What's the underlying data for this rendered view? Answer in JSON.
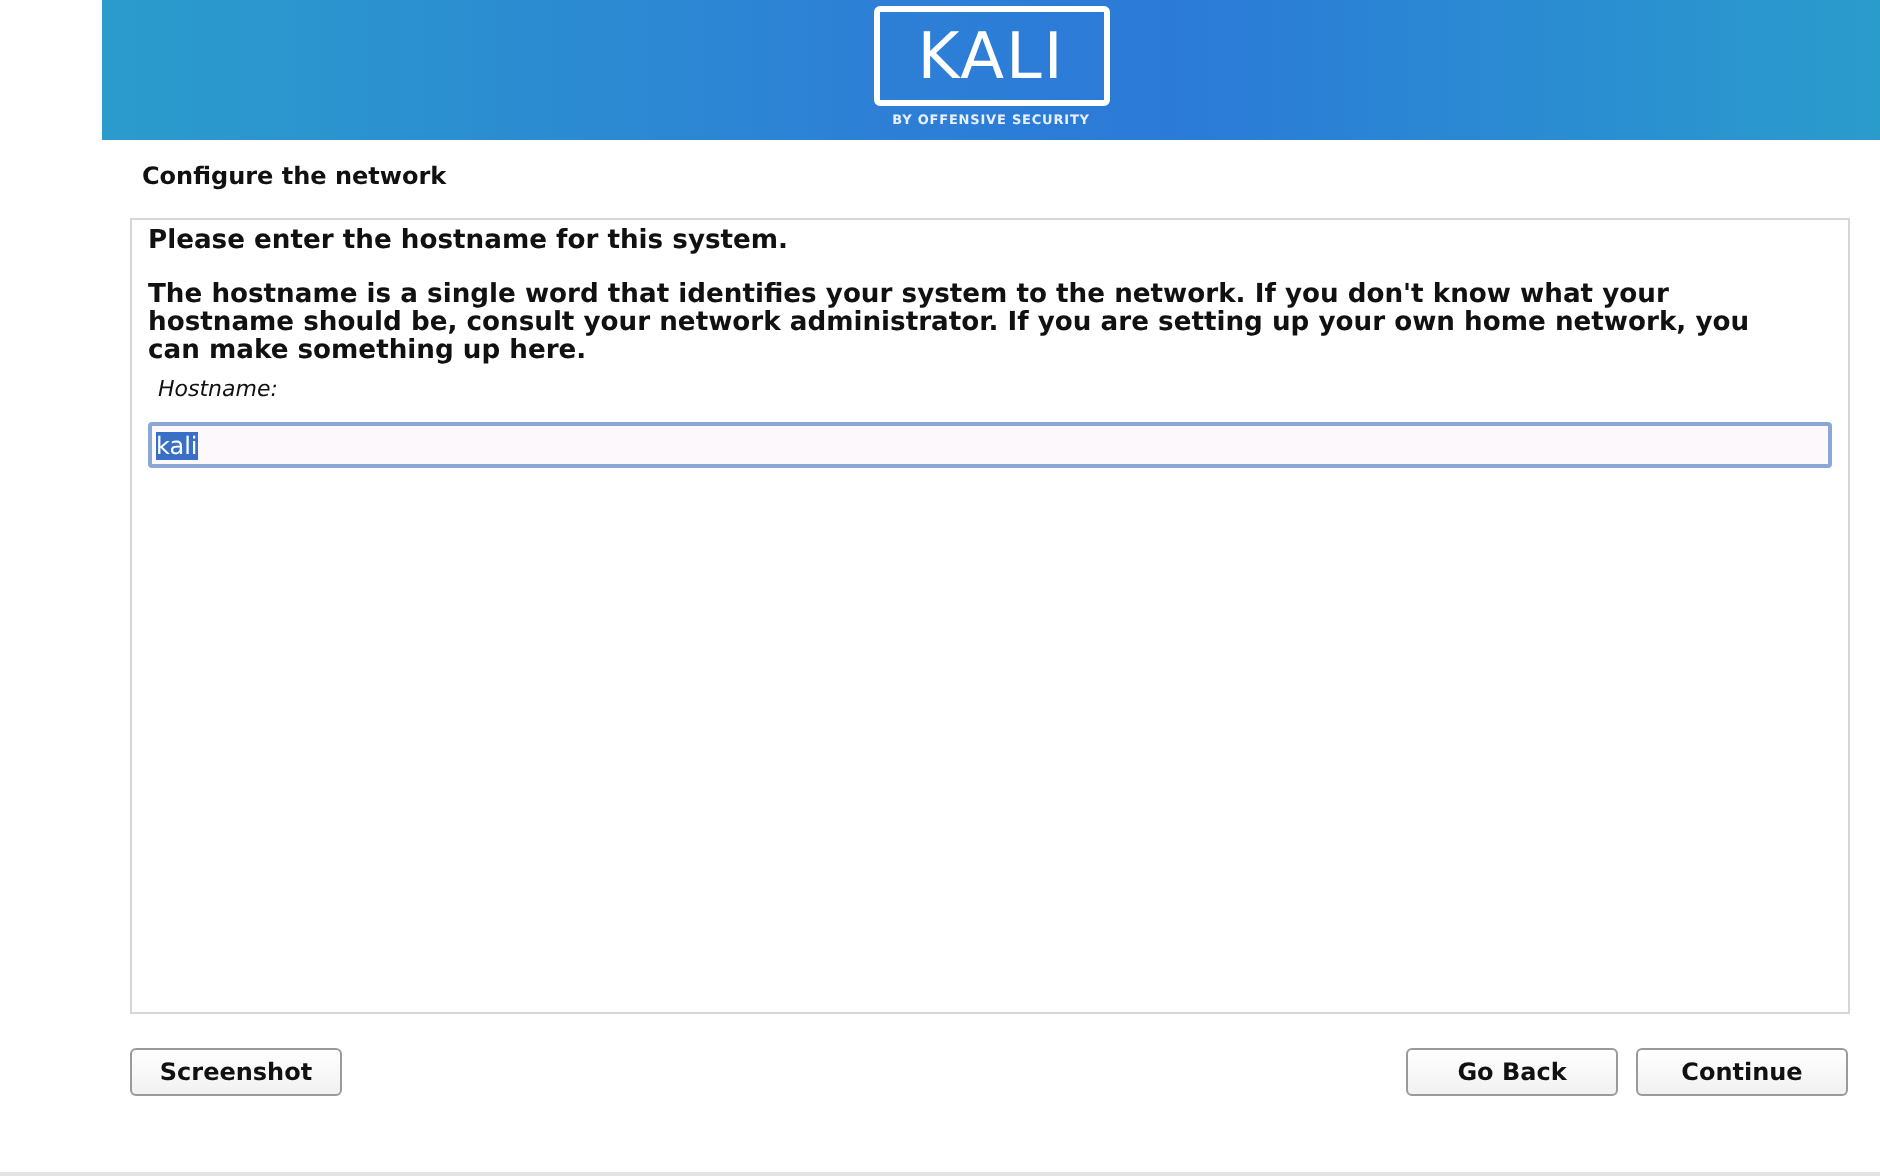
{
  "banner": {
    "logo": "KALI",
    "tagline": "BY OFFENSIVE SECURITY"
  },
  "title": "Configure the network",
  "panel": {
    "prompt": "Please enter the hostname for this system.",
    "description": "The hostname is a single word that identifies your system to the network. If you don't know what your hostname should be, consult your network administrator. If you are setting up your own home network, you can make something up here.",
    "field": {
      "label": "Hostname:",
      "value": "kali",
      "value_selected": true
    }
  },
  "left_buttons": [
    {
      "label": "Screenshot"
    }
  ],
  "right_buttons": [
    {
      "label": "Go Back"
    },
    {
      "label": "Continue"
    }
  ]
}
